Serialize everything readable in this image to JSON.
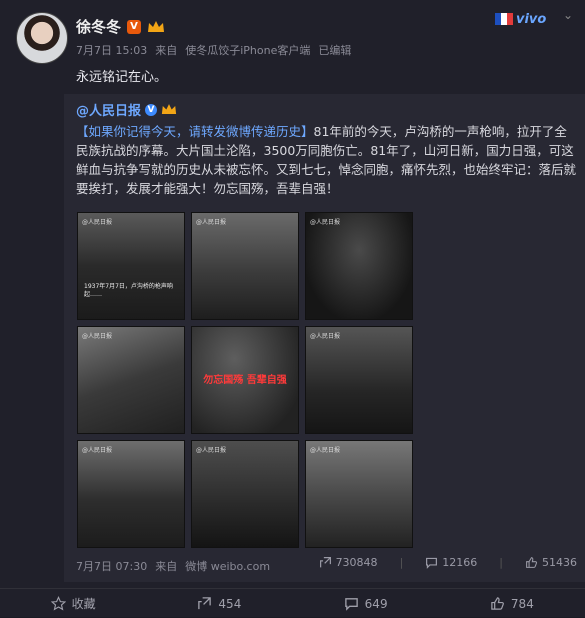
{
  "author": {
    "name": "徐冬冬",
    "verified_mark": "V"
  },
  "meta": {
    "date": "7月7日 15:03",
    "source_prefix": "来自",
    "source": "使冬瓜饺子iPhone客户端",
    "status": "已编辑"
  },
  "post_text": "永远铭记在心。",
  "vivo": {
    "label": "vivo",
    "flag_colors": [
      "#1d4fbf",
      "#ffffff",
      "#e23b3b"
    ]
  },
  "repost": {
    "author": "@人民日报",
    "hashtag": "【如果你记得今天，请转发微博传递历史】",
    "text": "81年前的今天，卢沟桥的一声枪响，拉开了全民族抗战的序幕。大片国土沦陷，3500万同胞伤亡。81年了，山河日新，国力日强，可这鲜血与抗争写就的历史从未被忘怀。又到七七，悼念同胞，痛怀先烈，也始终牢记：落后就要挨打，发展才能强大！勿忘国殇，吾辈自强！",
    "images": [
      {
        "wm": "@人民日报",
        "cap": "1937年7月7日，卢沟桥的枪声响起……",
        "red": ""
      },
      {
        "wm": "@人民日报",
        "cap": "",
        "red": ""
      },
      {
        "wm": "@人民日报",
        "cap": "",
        "red": ""
      },
      {
        "wm": "@人民日报",
        "cap": "",
        "red": ""
      },
      {
        "wm": "",
        "cap": "",
        "red": "勿忘国殇 吾辈自强"
      },
      {
        "wm": "@人民日报",
        "cap": "",
        "red": ""
      },
      {
        "wm": "@人民日报",
        "cap": "",
        "red": ""
      },
      {
        "wm": "@人民日报",
        "cap": "",
        "red": ""
      },
      {
        "wm": "@人民日报",
        "cap": "",
        "red": ""
      }
    ],
    "meta": {
      "date": "7月7日 07:30",
      "source_prefix": "来自",
      "source": "微博 weibo.com"
    },
    "counts": {
      "reposts": "730848",
      "comments": "12166",
      "likes": "51436"
    }
  },
  "actions": {
    "favorite": "收藏",
    "repost": "454",
    "comment": "649",
    "like": "784"
  }
}
